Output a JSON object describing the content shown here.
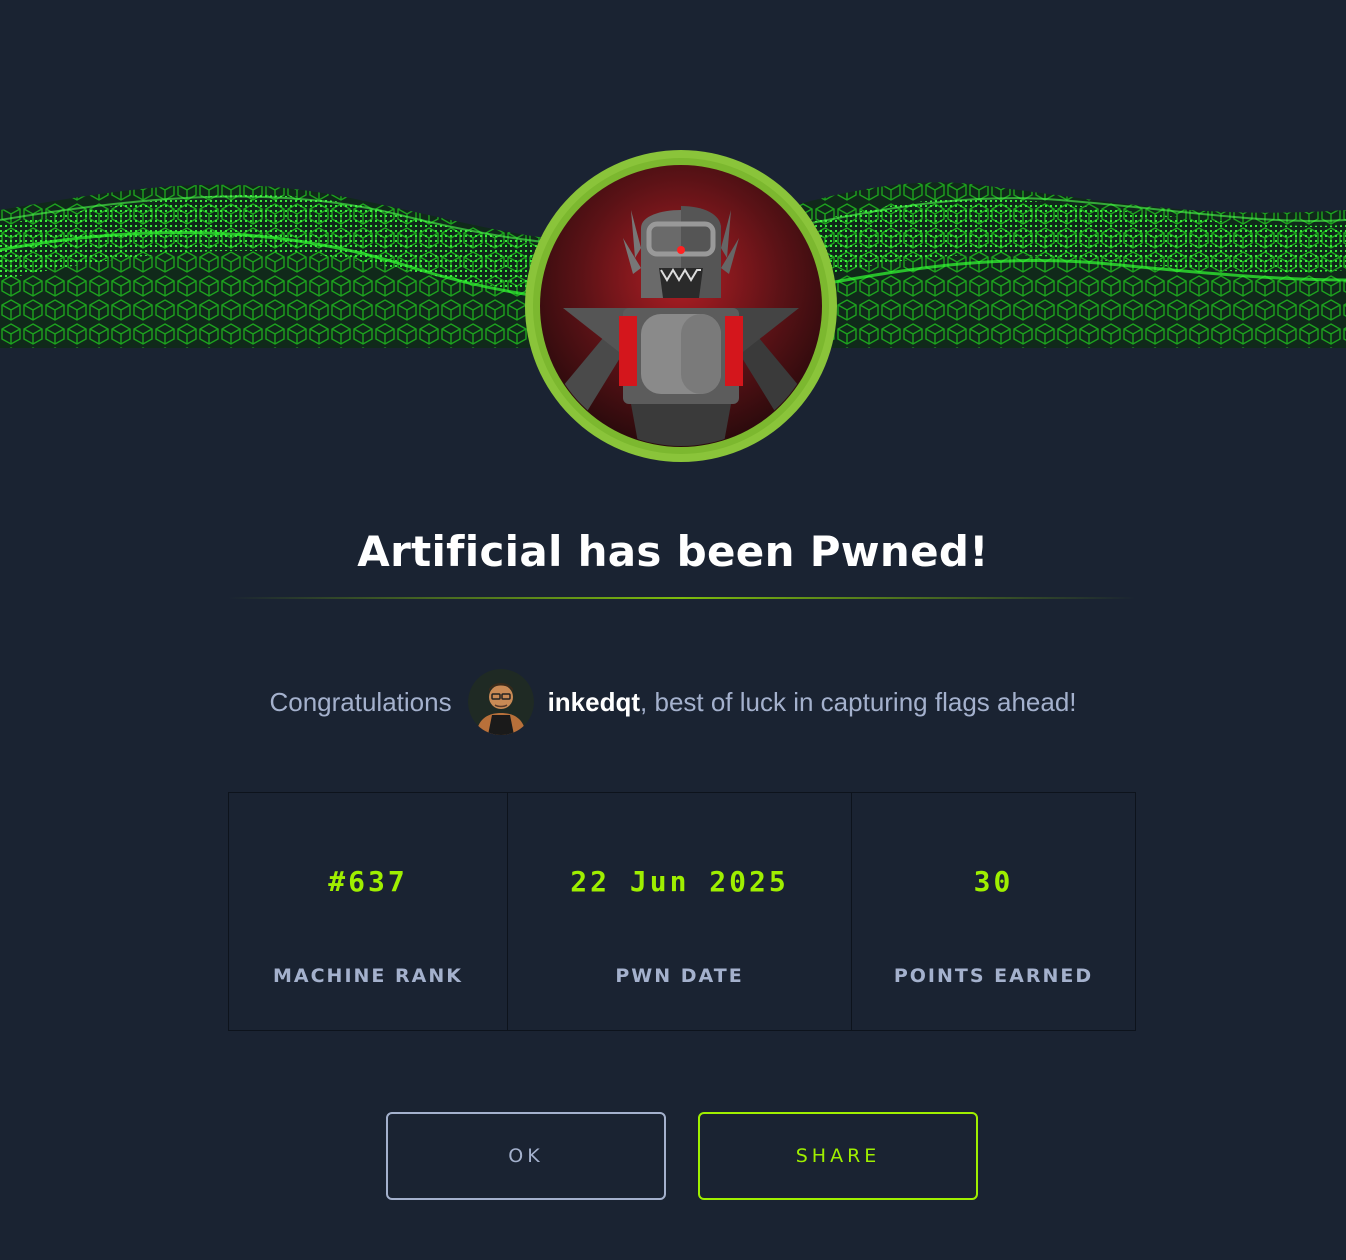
{
  "modal": {
    "title": "Artificial has been Pwned!",
    "congrats_prefix": "Congratulations",
    "username": "inkedqt",
    "congrats_suffix": ", best of luck in capturing flags ahead!"
  },
  "stats": [
    {
      "value": "#637",
      "label": "MACHINE RANK"
    },
    {
      "value": "22 Jun 2025",
      "label": "PWN DATE"
    },
    {
      "value": "30",
      "label": "POINTS EARNED"
    }
  ],
  "buttons": {
    "ok": "OK",
    "share": "SHARE"
  },
  "colors": {
    "background": "#1a2332",
    "accent": "#9fef00",
    "text_muted": "#a4b1cd",
    "banner_green": "#22ff22"
  },
  "icons": {
    "machine_avatar": "robot-avatar-icon",
    "user_avatar": "user-avatar-icon"
  }
}
